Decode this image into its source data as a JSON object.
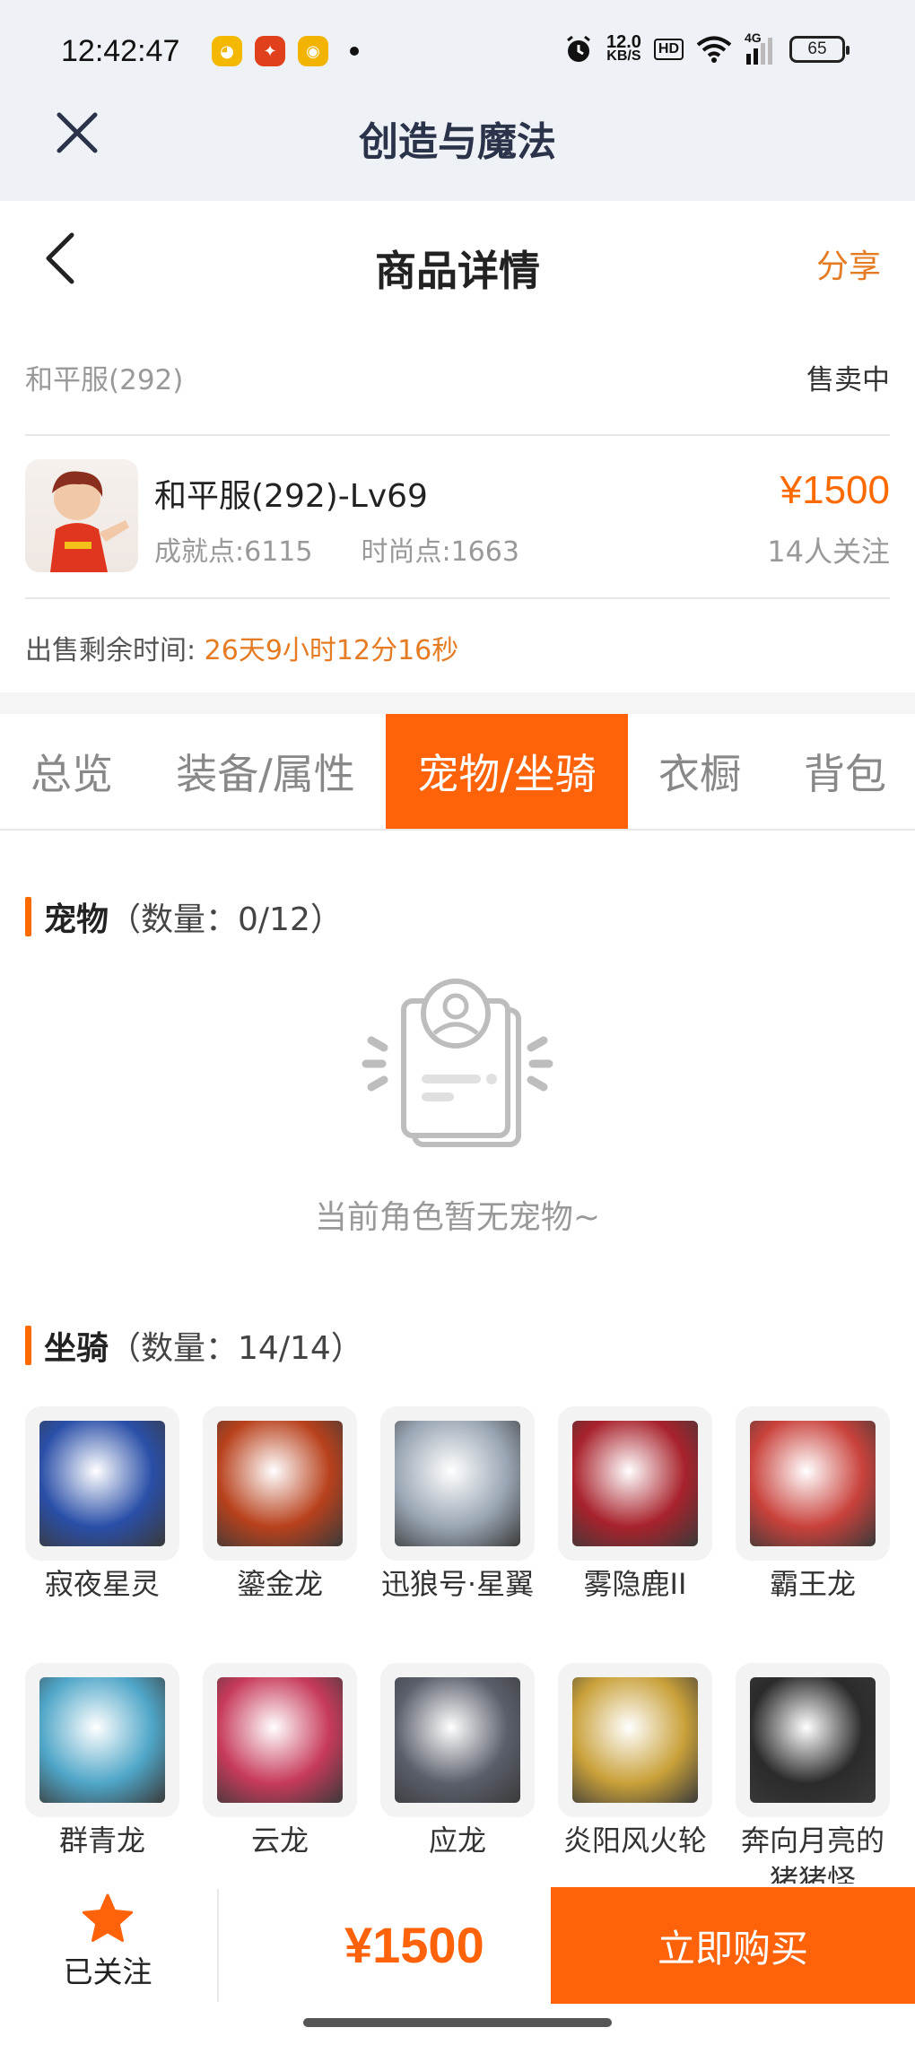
{
  "status_bar": {
    "time": "12:42:47",
    "net_speed_value": "12.0",
    "net_speed_unit": "KB/S",
    "hd": "HD",
    "signal": "4G",
    "battery": "65"
  },
  "app_bar": {
    "title": "创造与魔法"
  },
  "header": {
    "title": "商品详情",
    "share": "分享"
  },
  "listing": {
    "server": "和平服(292)",
    "status": "售卖中",
    "item_title": "和平服(292)-Lv69",
    "achievement": "成就点:6115",
    "fashion": "时尚点:1663",
    "price": "¥1500",
    "followers": "14人关注",
    "time_label": "出售剩余时间:",
    "time_value": "26天9小时12分16秒"
  },
  "tabs": [
    {
      "label": "总览"
    },
    {
      "label": "装备/属性"
    },
    {
      "label": "宠物/坐骑",
      "active": true
    },
    {
      "label": "衣橱"
    },
    {
      "label": "背包"
    }
  ],
  "pets": {
    "title": "宠物",
    "count": "（数量：0/12）",
    "empty_text": "当前角色暂无宠物~"
  },
  "mounts": {
    "title": "坐骑",
    "count": "（数量：14/14）",
    "items": [
      {
        "name": "寂夜星灵",
        "color": "#2a4fa8"
      },
      {
        "name": "鎏金龙",
        "color": "#b8411c"
      },
      {
        "name": "迅狼号·星翼",
        "color": "#9aa6b4"
      },
      {
        "name": "雾隐鹿II",
        "color": "#a8222c"
      },
      {
        "name": "霸王龙",
        "color": "#c9413b"
      },
      {
        "name": "群青龙",
        "color": "#4fa6c8"
      },
      {
        "name": "云龙",
        "color": "#c73a5a"
      },
      {
        "name": "应龙",
        "color": "#5a5f6b"
      },
      {
        "name": "炎阳风火轮",
        "color": "#c9a13a"
      },
      {
        "name": "奔向月亮的猪猪怪",
        "color": "#2b2b2b"
      }
    ]
  },
  "bottom": {
    "follow_label": "已关注",
    "price": "¥1500",
    "buy_label": "立即购买"
  },
  "colors": {
    "accent": "#ff6208",
    "price": "#ff6a00",
    "time": "#e57b23"
  }
}
